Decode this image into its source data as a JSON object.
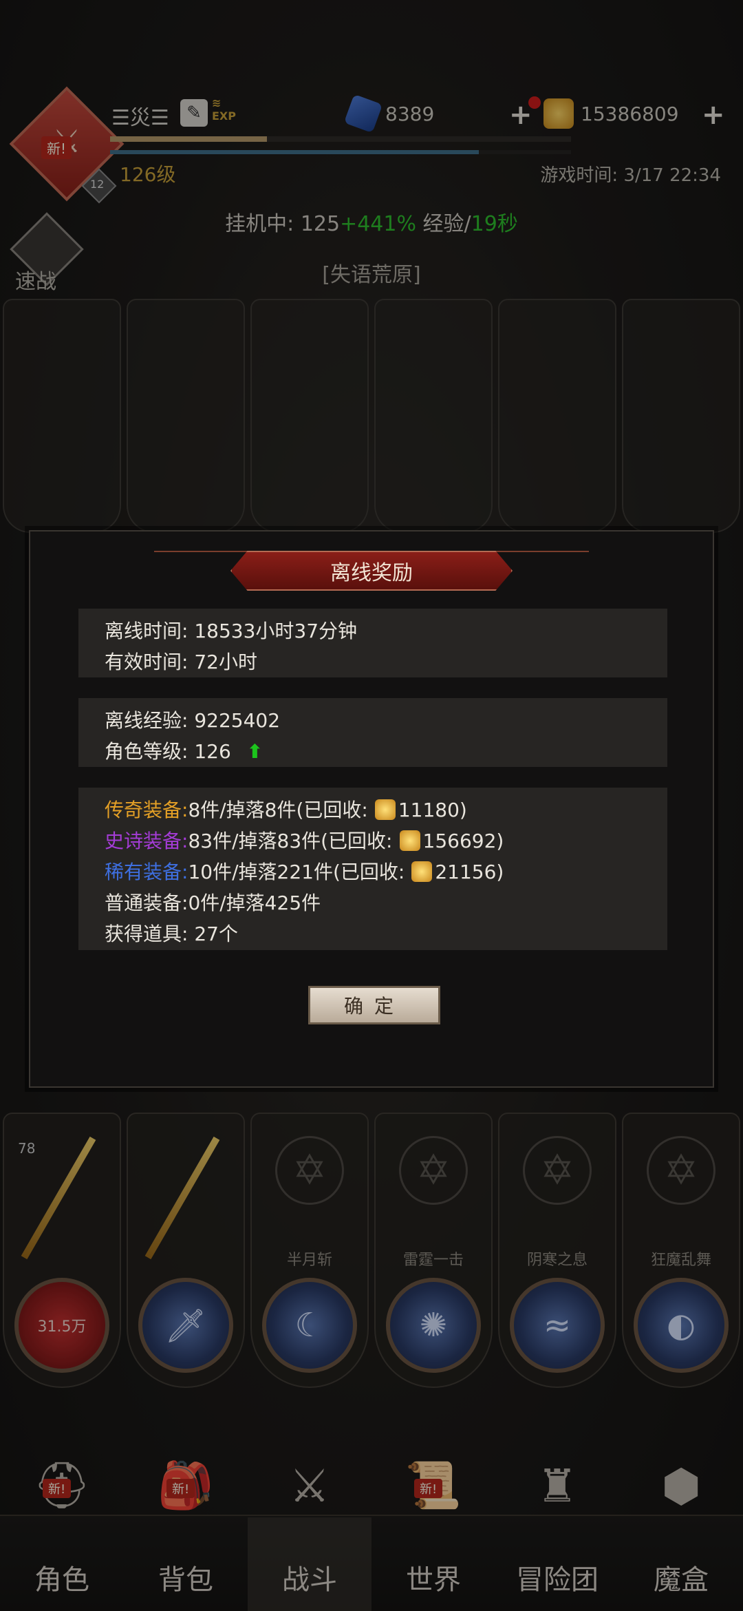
{
  "player": {
    "name": "☰災☰",
    "level": "126级",
    "emblem_new": "新!",
    "rank_badge": "12",
    "exp_progress": 0.34,
    "mp_progress": 0.8
  },
  "currency": {
    "gems": "8389",
    "gold": "15386809"
  },
  "game_time": "游戏时间: 3/17 22:34",
  "idle": {
    "prefix": "挂机中: 125",
    "bonus": "+441%",
    "middle": " 经验/",
    "rate": "19秒"
  },
  "quick_fight_label": "速战",
  "map_name": "[失语荒原]",
  "dialog": {
    "title": "离线奖励",
    "offline_time_label": "离线时间:",
    "offline_time": "18533小时37分钟",
    "valid_time_label": "有效时间:",
    "valid_time": "72小时",
    "exp_label": "离线经验:",
    "exp_value": "9225402",
    "char_level_label": "角色等级:",
    "char_level_value": "126",
    "legend_label": "传奇装备:",
    "legend_text": "8件/掉落8件(已回收:",
    "legend_gold": "11180)",
    "epic_label": "史诗装备:",
    "epic_text": "83件/掉落83件(已回收:",
    "epic_gold": "156692)",
    "rare_label": "稀有装备:",
    "rare_text": "10件/掉落221件(已回收:",
    "rare_gold": "21156)",
    "normal_label": "普通装备:",
    "normal_text": "0件/掉落425件",
    "items_label": "获得道具:",
    "items_text": "27个",
    "ok_button": "确定"
  },
  "skills": {
    "hp_value": "31.5万",
    "level_badge": "78",
    "names": [
      "半月斩",
      "雷霆一击",
      "阴寒之息",
      "狂魔乱舞"
    ]
  },
  "nav": {
    "items": [
      "角色",
      "背包",
      "战斗",
      "世界",
      "冒险团",
      "魔盒"
    ],
    "new_badge": "新!"
  },
  "colors": {
    "legend": "#e4a026",
    "epic": "#a43cd6",
    "rare": "#3e6fe0",
    "bonus_green": "#2ec02e",
    "title_red": "#8a1e18"
  }
}
